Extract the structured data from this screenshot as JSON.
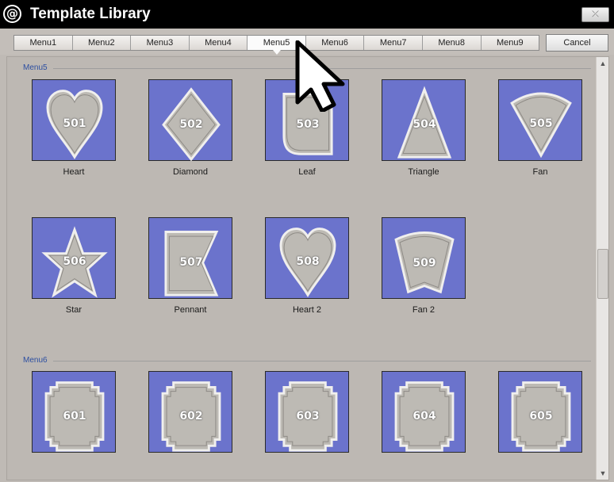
{
  "window": {
    "title": "Template Library",
    "close_icon": "close-icon",
    "close_label": "⤫"
  },
  "menubar": {
    "tabs": [
      "Menu1",
      "Menu2",
      "Menu3",
      "Menu4",
      "Menu5",
      "Menu6",
      "Menu7",
      "Menu8",
      "Menu9"
    ],
    "active_tab": "Menu5",
    "cancel_label": "Cancel"
  },
  "sections": [
    {
      "header": "Menu5",
      "items": [
        {
          "num": "501",
          "label": "Heart",
          "shape": "heart"
        },
        {
          "num": "502",
          "label": "Diamond",
          "shape": "diamond"
        },
        {
          "num": "503",
          "label": "Leaf",
          "shape": "leaf"
        },
        {
          "num": "504",
          "label": "Triangle",
          "shape": "triangle"
        },
        {
          "num": "505",
          "label": "Fan",
          "shape": "fan"
        },
        {
          "num": "506",
          "label": "Star",
          "shape": "star"
        },
        {
          "num": "507",
          "label": "Pennant",
          "shape": "pennant"
        },
        {
          "num": "508",
          "label": "Heart 2",
          "shape": "heart"
        },
        {
          "num": "509",
          "label": "Fan 2",
          "shape": "fan2"
        }
      ]
    },
    {
      "header": "Menu6",
      "items": [
        {
          "num": "601",
          "label": "",
          "shape": "frame"
        },
        {
          "num": "602",
          "label": "",
          "shape": "frame"
        },
        {
          "num": "603",
          "label": "",
          "shape": "frame"
        },
        {
          "num": "604",
          "label": "",
          "shape": "frame"
        },
        {
          "num": "605",
          "label": "",
          "shape": "frame"
        }
      ]
    }
  ],
  "colors": {
    "card_bg": "#6b73cc",
    "shape_fill": "#bdbab4",
    "header_text": "#2d4fa1",
    "window_bg": "#bfbab5"
  }
}
